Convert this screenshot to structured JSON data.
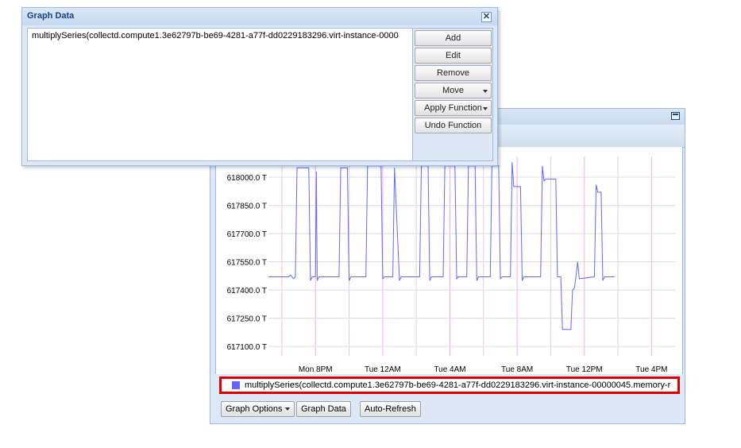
{
  "data_window": {
    "title": "Graph Data",
    "close_glyph": "✕",
    "target": "multiplySeries(collectd.compute1.3e62797b-be69-4281-a77f-dd0229183296.virt-instance-0000",
    "buttons": {
      "add": "Add",
      "edit": "Edit",
      "remove": "Remove",
      "move": "Move",
      "apply_function": "Apply Function",
      "undo_function": "Undo Function"
    }
  },
  "graph_window": {
    "legend": "multiplySeries(collectd.compute1.3e62797b-be69-4281-a77f-dd0229183296.virt-instance-00000045.memory-r",
    "buttons": {
      "graph_options": "Graph Options",
      "graph_data": "Graph Data",
      "auto_refresh": "Auto-Refresh"
    }
  },
  "icons": [
    "close-icon",
    "restore-icon",
    "dropdown-caret-icon"
  ],
  "colors": {
    "series": "#6666ff",
    "legend_highlight": "#e00000",
    "title": "#15428b"
  },
  "chart_data": {
    "type": "line",
    "ytick_labels": [
      "618000.0 T",
      "617850.0 T",
      "617700.0 T",
      "617550.0 T",
      "617400.0 T",
      "617250.0 T",
      "617100.0 T"
    ],
    "ytick_values": [
      618000,
      617850,
      617700,
      617550,
      617400,
      617250,
      617100
    ],
    "xtick_labels": [
      "Mon  8PM",
      "Tue 12AM",
      "Tue  4AM",
      "Tue  8AM",
      "Tue 12PM",
      "Tue  4PM"
    ],
    "ylim": [
      617050,
      618110
    ],
    "xlim_hours_from_first_tick": [
      -2.8,
      21.4
    ],
    "grid": true,
    "series": [
      {
        "name": "multiplySeries(collectd.compute1.3e62797b-be69-4281-a77f-dd0229183296.virt-instance-00000045.memory-r",
        "points": [
          [
            -2.8,
            617470
          ],
          [
            -1.6,
            617470
          ],
          [
            -1.5,
            617480
          ],
          [
            -1.3,
            617460
          ],
          [
            -1.2,
            617470
          ],
          [
            -1.1,
            618050
          ],
          [
            -0.4,
            618050
          ],
          [
            -0.3,
            617450
          ],
          [
            -0.2,
            617470
          ],
          [
            0.0,
            617470
          ],
          [
            0.05,
            618030
          ],
          [
            0.1,
            617450
          ],
          [
            0.2,
            617470
          ],
          [
            1.4,
            617470
          ],
          [
            1.5,
            618050
          ],
          [
            1.9,
            618050
          ],
          [
            2.0,
            617450
          ],
          [
            2.1,
            617470
          ],
          [
            3.0,
            617470
          ],
          [
            3.1,
            618060
          ],
          [
            3.9,
            618060
          ],
          [
            4.0,
            617460
          ],
          [
            4.1,
            617470
          ],
          [
            4.6,
            617470
          ],
          [
            4.7,
            618050
          ],
          [
            5.0,
            617450
          ],
          [
            5.1,
            617470
          ],
          [
            6.2,
            617470
          ],
          [
            6.3,
            618060
          ],
          [
            6.7,
            618060
          ],
          [
            6.8,
            617450
          ],
          [
            6.9,
            617470
          ],
          [
            7.6,
            617470
          ],
          [
            7.7,
            618060
          ],
          [
            8.3,
            618060
          ],
          [
            8.4,
            617460
          ],
          [
            8.5,
            617470
          ],
          [
            9.0,
            617470
          ],
          [
            9.1,
            618060
          ],
          [
            9.5,
            618060
          ],
          [
            9.6,
            617450
          ],
          [
            9.7,
            617470
          ],
          [
            10.4,
            617470
          ],
          [
            10.5,
            618060
          ],
          [
            10.9,
            618060
          ],
          [
            11.0,
            617460
          ],
          [
            11.1,
            617470
          ],
          [
            11.6,
            617470
          ],
          [
            11.7,
            618080
          ],
          [
            11.8,
            617950
          ],
          [
            12.2,
            617950
          ],
          [
            12.3,
            617450
          ],
          [
            12.4,
            617470
          ],
          [
            13.4,
            617470
          ],
          [
            13.5,
            618060
          ],
          [
            13.6,
            617980
          ],
          [
            13.7,
            617990
          ],
          [
            14.3,
            617990
          ],
          [
            14.4,
            617470
          ],
          [
            14.6,
            617470
          ],
          [
            14.7,
            617190
          ],
          [
            15.2,
            617190
          ],
          [
            15.3,
            617400
          ],
          [
            15.4,
            617410
          ],
          [
            15.5,
            617470
          ],
          [
            15.6,
            617550
          ],
          [
            15.7,
            617460
          ],
          [
            16.6,
            617470
          ],
          [
            16.7,
            617960
          ],
          [
            16.8,
            617920
          ],
          [
            17.0,
            617920
          ],
          [
            17.1,
            617450
          ],
          [
            17.2,
            617470
          ],
          [
            17.8,
            617470
          ]
        ]
      }
    ]
  }
}
